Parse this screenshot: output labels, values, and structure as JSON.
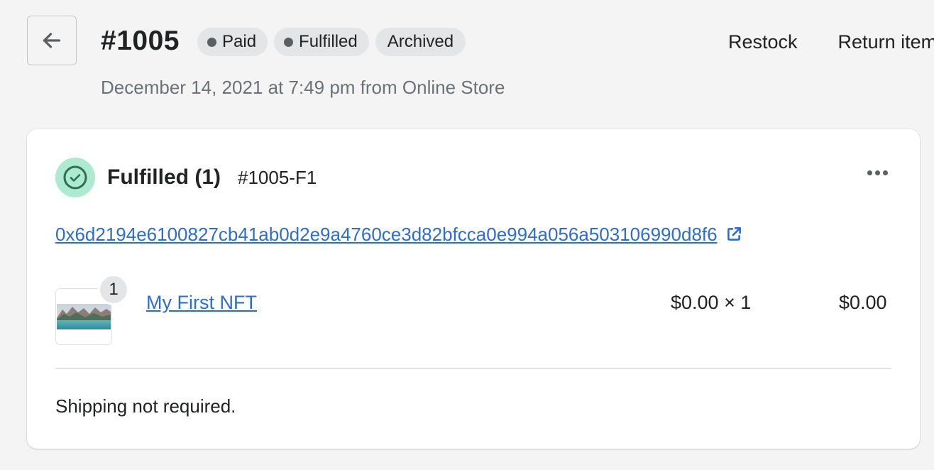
{
  "header": {
    "order_number": "#1005",
    "badges": [
      {
        "label": "Paid",
        "has_dot": true
      },
      {
        "label": "Fulfilled",
        "has_dot": true
      },
      {
        "label": "Archived",
        "has_dot": false
      }
    ],
    "actions": [
      {
        "label": "Restock"
      },
      {
        "label": "Return items"
      }
    ],
    "subtitle": "December 14, 2021 at 7:49 pm from Online Store",
    "back_icon": "arrow-left-icon"
  },
  "fulfillment": {
    "status_icon": "check-circle-icon",
    "title": "Fulfilled (1)",
    "id": "#1005-F1",
    "more_icon": "horizontal-dots-icon",
    "transaction_hash": "0x6d2194e6100827cb41ab0d2e9a4760ce3d82bfcca0e994a056a503106990d8f6",
    "external_icon": "external-link-icon",
    "line_item": {
      "quantity_badge": "1",
      "name": "My First NFT",
      "unit_price": "$0.00 × 1",
      "total": "$0.00",
      "thumbnail": "mountain-lake-image"
    },
    "shipping_note": "Shipping not required."
  },
  "colors": {
    "background": "#f4f4f4",
    "card": "#ffffff",
    "link": "#2c6ecb",
    "badge_bg": "#e4e5e7",
    "success_bg": "#aee9d1",
    "success_fg": "#2f6f55",
    "muted_text": "#6d7175"
  }
}
